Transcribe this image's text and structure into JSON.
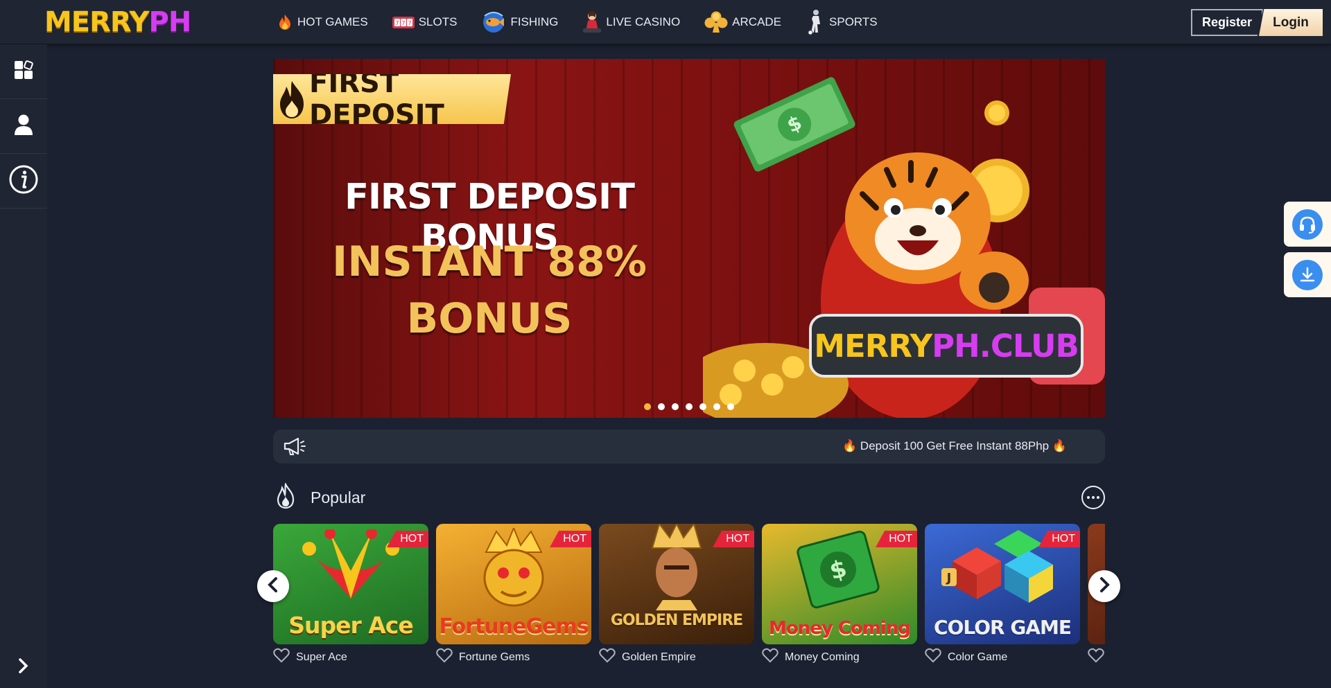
{
  "header": {
    "logo_part1": "MERRY",
    "logo_part2": "PH",
    "nav": [
      {
        "label": "HOT GAMES",
        "icon": "flame-icon"
      },
      {
        "label": "SLOTS",
        "icon": "slot-machine-icon"
      },
      {
        "label": "FISHING",
        "icon": "fish-icon"
      },
      {
        "label": "LIVE CASINO",
        "icon": "dealer-icon"
      },
      {
        "label": "ARCADE",
        "icon": "club-suit-icon"
      },
      {
        "label": "SPORTS",
        "icon": "soccer-player-icon"
      }
    ],
    "register_label": "Register",
    "login_label": "Login"
  },
  "sidebar": {
    "items": [
      {
        "icon": "apps-icon"
      },
      {
        "icon": "user-icon"
      },
      {
        "icon": "info-icon"
      }
    ],
    "expand_icon": "chevron-right-icon"
  },
  "banner": {
    "tag": "FIRST DEPOSIT",
    "line1": "FIRST DEPOSIT BONUS",
    "line2": "INSTANT 88%",
    "line3": "BONUS",
    "club_part1": "MERRY",
    "club_part2": "PH.CLUB",
    "slide_count": 7,
    "active_slide": 1
  },
  "announcement": {
    "icon": "megaphone-icon",
    "text": "🔥 Deposit 100 Get Free Instant 88Php 🔥"
  },
  "popular": {
    "title": "Popular",
    "icon": "flame-icon",
    "more_icon": "more-icon",
    "badge": "HOT",
    "games": [
      {
        "name": "Super Ace",
        "thumb_text": "Super Ace",
        "bg1": "#3aa83a",
        "bg2": "#1e6b23",
        "fg": "#f7d34a"
      },
      {
        "name": "Fortune Gems",
        "thumb_text": "FortuneGems",
        "bg1": "#f4b133",
        "bg2": "#b86a10",
        "fg": "#e83b1f"
      },
      {
        "name": "Golden Empire",
        "thumb_text": "GOLDEN EMPIRE",
        "bg1": "#7a4a1e",
        "bg2": "#3a1f0a",
        "fg": "#f2c45a"
      },
      {
        "name": "Money Coming",
        "thumb_text": "Money Coming",
        "bg1": "#e7b92c",
        "bg2": "#2f8a2a",
        "fg": "#e8282f"
      },
      {
        "name": "Color Game",
        "thumb_text": "COLOR GAME",
        "bg1": "#3b6ad6",
        "bg2": "#1c2f7a",
        "fg": "#f0f0f0"
      },
      {
        "name": "",
        "thumb_text": "",
        "bg1": "#8a3a1c",
        "bg2": "#4a1a0c",
        "fg": "#ffffff"
      }
    ]
  },
  "floating": {
    "support_icon": "headset-icon",
    "download_icon": "download-icon"
  },
  "colors": {
    "bg": "#1b2130",
    "header": "#1f2532",
    "accent_gold": "#f4b73a",
    "logo_yellow": "#f7c51c",
    "logo_pink": "#d63cf0",
    "hot_red": "#e5243b",
    "float_blue": "#3a8ef0"
  }
}
